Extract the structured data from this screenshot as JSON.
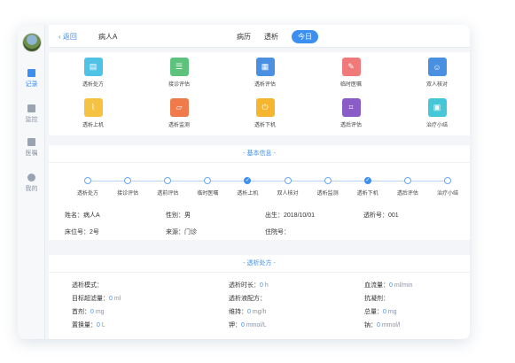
{
  "sidebar": {
    "items": [
      {
        "label": "记录",
        "icon": "pen-icon",
        "active": true
      },
      {
        "label": "监控",
        "icon": "chart-icon",
        "active": false
      },
      {
        "label": "医嘱",
        "icon": "document-icon",
        "active": false
      },
      {
        "label": "我的",
        "icon": "user-icon",
        "active": false
      }
    ]
  },
  "topbar": {
    "back_label": "返回",
    "patient": "病人A",
    "tabs": [
      {
        "label": "病历",
        "active": false
      },
      {
        "label": "透析",
        "active": false
      },
      {
        "label": "今日",
        "active": true
      }
    ]
  },
  "grid": [
    {
      "label": "透析处方",
      "icon": "prescription-icon",
      "color": "#4fc3e6"
    },
    {
      "label": "接诊评估",
      "icon": "checklist-icon",
      "color": "#5cc27c"
    },
    {
      "label": "透析评估",
      "icon": "document-icon",
      "color": "#4a90e2"
    },
    {
      "label": "临时医嘱",
      "icon": "edit-icon",
      "color": "#f07a7a"
    },
    {
      "label": "双人核对",
      "icon": "users-icon",
      "color": "#4a90e2"
    },
    {
      "label": "透析上机",
      "icon": "clip-icon",
      "color": "#f5c242"
    },
    {
      "label": "透析监测",
      "icon": "monitor-icon",
      "color": "#f07a4a"
    },
    {
      "label": "透析下机",
      "icon": "power-icon",
      "color": "#f5b52e"
    },
    {
      "label": "透后评估",
      "icon": "crop-icon",
      "color": "#8a5cc8"
    },
    {
      "label": "治疗小结",
      "icon": "summary-icon",
      "color": "#44c7d6"
    }
  ],
  "info": {
    "title": "- 基本信息 -",
    "steps": [
      {
        "label": "透析处方",
        "done": false
      },
      {
        "label": "接诊评估",
        "done": false
      },
      {
        "label": "透前评估",
        "done": false
      },
      {
        "label": "临时医嘱",
        "done": false
      },
      {
        "label": "透析上机",
        "done": true
      },
      {
        "label": "双人核对",
        "done": false
      },
      {
        "label": "透析监测",
        "done": false
      },
      {
        "label": "透析下机",
        "done": true
      },
      {
        "label": "透后评估",
        "done": false
      },
      {
        "label": "治疗小结",
        "done": false
      }
    ],
    "name": "姓名：病人A",
    "gender": "性别：男",
    "birth": "出生：2018/10/01",
    "dialysis_no": "透析号：001",
    "bed": "床位号：2号",
    "source": "来源：门诊",
    "admission": "住院号："
  },
  "prescription": {
    "title": "- 透析处方 -",
    "rows": [
      [
        {
          "label": "透析模式：",
          "zero": "",
          "unit": ""
        },
        {
          "label": "透析时长：",
          "zero": "0",
          "unit": " h"
        },
        {
          "label": "血流量：",
          "zero": "0",
          "unit": " ml/min"
        }
      ],
      [
        {
          "label": "目标超滤量：",
          "zero": "0",
          "unit": " ml"
        },
        {
          "label": "透析液配方：",
          "zero": "",
          "unit": ""
        },
        {
          "label": "抗凝剂：",
          "zero": "",
          "unit": ""
        }
      ],
      [
        {
          "label": "首剂：",
          "zero": "0",
          "unit": " mg"
        },
        {
          "label": "维持：",
          "zero": "0",
          "unit": " mg/h"
        },
        {
          "label": "总量：",
          "zero": "0",
          "unit": " mg"
        }
      ],
      [
        {
          "label": "置换量：",
          "zero": "0",
          "unit": " L"
        },
        {
          "label": "钾：",
          "zero": "0",
          "unit": " mmol/L"
        },
        {
          "label": "钠：",
          "zero": "0",
          "unit": " mmol/l"
        }
      ]
    ]
  }
}
